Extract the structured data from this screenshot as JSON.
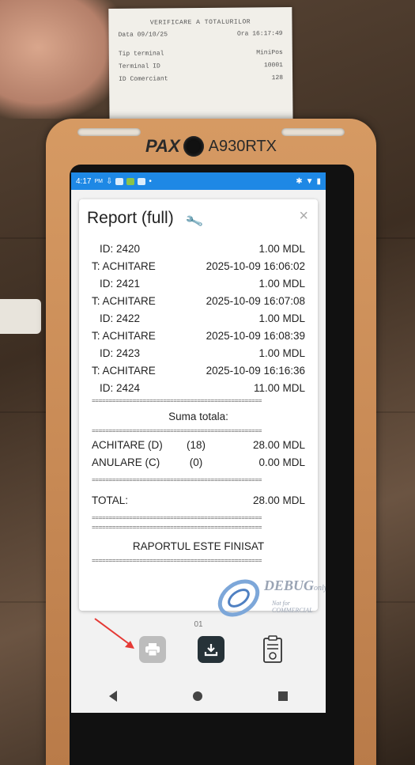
{
  "receipt": {
    "title": "VERIFICARE A TOTALURILOR",
    "lines": [
      {
        "l": "Data  09/10/25",
        "r": "Ora  16:17:49"
      },
      {
        "l": "Tip terminal",
        "r": "MiniPos"
      },
      {
        "l": "Terminal ID",
        "r": "10001"
      },
      {
        "l": "ID Comerciant",
        "r": "128"
      }
    ]
  },
  "device": {
    "brand": "PAX",
    "model": "A930RTX"
  },
  "status": {
    "time": "4:17",
    "ampm": "PM"
  },
  "dialog": {
    "title": "Report (full)",
    "close": "×"
  },
  "report": {
    "entries": [
      {
        "l": "ID: 2420",
        "r": "1.00 MDL",
        "kind": "id"
      },
      {
        "l": "T: ACHITARE",
        "r": "2025-10-09 16:06:02",
        "kind": "t"
      },
      {
        "l": "ID: 2421",
        "r": "1.00 MDL",
        "kind": "id"
      },
      {
        "l": "T: ACHITARE",
        "r": "2025-10-09 16:07:08",
        "kind": "t"
      },
      {
        "l": "ID: 2422",
        "r": "1.00 MDL",
        "kind": "id"
      },
      {
        "l": "T: ACHITARE",
        "r": "2025-10-09 16:08:39",
        "kind": "t"
      },
      {
        "l": "ID: 2423",
        "r": "1.00 MDL",
        "kind": "id"
      },
      {
        "l": "T: ACHITARE",
        "r": "2025-10-09 16:16:36",
        "kind": "t"
      },
      {
        "l": "ID: 2424",
        "r": "11.00 MDL",
        "kind": "id"
      }
    ],
    "separator": "==================================================",
    "sum_label": "Suma totala:",
    "sums": [
      {
        "label": "ACHITARE (D)",
        "count": "(18)",
        "amount": "28.00 MDL"
      },
      {
        "label": "ANULARE (C)",
        "count": "(0)",
        "amount": "0.00 MDL"
      }
    ],
    "total_label": "TOTAL:",
    "total_amount": "28.00 MDL",
    "finished": "RAPORTUL ESTE FINISAT"
  },
  "watermark": {
    "text": "DEBUG",
    "suffix": "only",
    "sub": "Not for COMMERCIAL"
  },
  "page_number": "01",
  "colors": {
    "statusbar": "#1e88e5",
    "device_body": "#c98b56",
    "arrow": "#e53935"
  }
}
